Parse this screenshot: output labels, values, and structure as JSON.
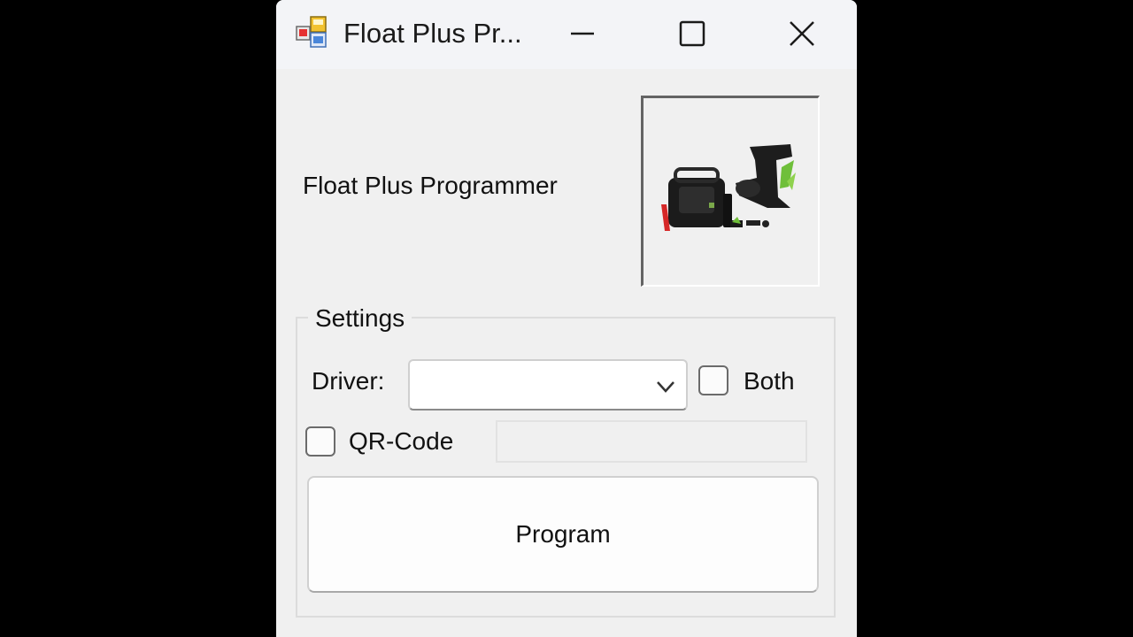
{
  "window": {
    "title": "Float Plus Pr...",
    "icon": "app-window-icon",
    "controls": [
      "minimize-icon",
      "maximize-icon",
      "close-icon"
    ]
  },
  "header": {
    "label": "Float Plus Programmer",
    "product_image": "product-image"
  },
  "settings": {
    "group_label": "Settings",
    "driver_label": "Driver:",
    "driver_value": "",
    "both_label": "Both",
    "both_checked": false,
    "qr_label": "QR-Code",
    "qr_checked": false,
    "qr_value": ""
  },
  "actions": {
    "program_label": "Program"
  },
  "colors": {
    "background": "#000000",
    "window_bg": "#f0f0f0",
    "titlebar_bg": "#f3f4f7"
  }
}
